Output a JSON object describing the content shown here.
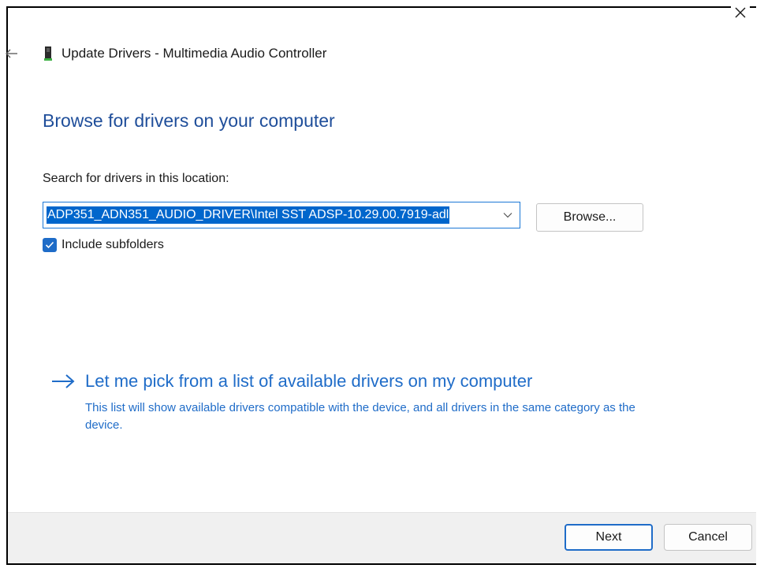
{
  "window": {
    "title": "Update Drivers - Multimedia Audio Controller"
  },
  "main": {
    "heading": "Browse for drivers on your computer",
    "search_label": "Search for drivers in this location:",
    "path_value": "ADP351_ADN351_AUDIO_DRIVER\\Intel SST ADSP-10.29.00.7919-adl",
    "browse_label": "Browse...",
    "include_subfolders_label": "Include subfolders",
    "include_subfolders_checked": true,
    "pick_title": "Let me pick from a list of available drivers on my computer",
    "pick_description": "This list will show available drivers compatible with the device, and all drivers in the same category as the device."
  },
  "footer": {
    "next_label": "Next",
    "cancel_label": "Cancel"
  },
  "colors": {
    "heading": "#1f4e9a",
    "link": "#1f6cc8",
    "selection": "#0066cc",
    "checkbox": "#1e6cc8",
    "footer_bg": "#f0f0f0"
  },
  "icons": {
    "back": "back-arrow-icon",
    "close": "close-icon",
    "device": "device-icon",
    "chevron": "chevron-down-icon",
    "check": "checkmark-icon",
    "link_arrow": "right-arrow-icon"
  }
}
